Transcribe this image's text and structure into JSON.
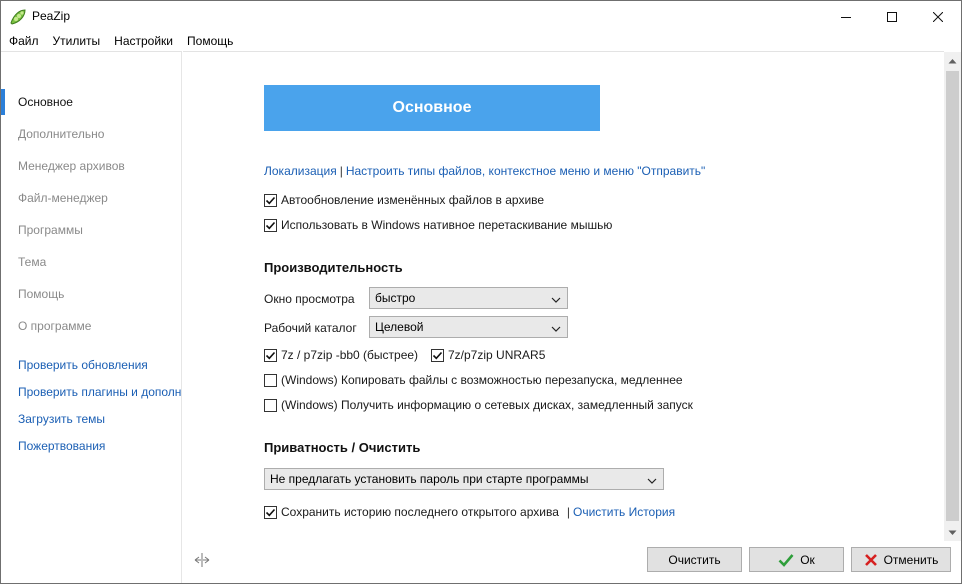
{
  "window": {
    "title": "PeaZip",
    "icon": "peazip-pea-icon"
  },
  "menu": [
    "Файл",
    "Утилиты",
    "Настройки",
    "Помощь"
  ],
  "sidebar": {
    "items": [
      {
        "label": "Основное",
        "active": true
      },
      {
        "label": "Дополнительно",
        "active": false
      },
      {
        "label": "Менеджер архивов",
        "active": false
      },
      {
        "label": "Файл-менеджер",
        "active": false
      },
      {
        "label": "Программы",
        "active": false
      },
      {
        "label": "Тема",
        "active": false
      },
      {
        "label": "Помощь",
        "active": false
      },
      {
        "label": "О программе",
        "active": false
      }
    ],
    "links": [
      "Проверить обновления",
      "Проверить плагины и дополн",
      "Загрузить темы",
      "Пожертвования"
    ]
  },
  "main": {
    "header": "Основное",
    "link_localization": "Локализация",
    "link_separator": "|",
    "link_filetypes": "Настроить типы файлов, контекстное меню и меню \"Отправить\"",
    "options": [
      {
        "label": "Автообновление изменённых файлов в архиве",
        "checked": true
      },
      {
        "label": "Использовать в Windows нативное перетаскивание мышью",
        "checked": true
      }
    ],
    "performance": {
      "title": "Производительность",
      "preview_label": "Окно просмотра",
      "preview_value": "быстро",
      "workdir_label": "Рабочий каталог",
      "workdir_value": "Целевой",
      "opt_7z_bb0": {
        "label": "7z / p7zip -bb0 (быстрее)",
        "checked": true
      },
      "opt_unrar": {
        "label": "7z/p7zip UNRAR5",
        "checked": true
      },
      "opt_copy_restart": {
        "label": "(Windows) Копировать файлы с возможностью перезапуска, медленнее",
        "checked": false
      },
      "opt_network_info": {
        "label": "(Windows) Получить информацию о сетевых дисках, замедленный запуск",
        "checked": false
      }
    },
    "privacy": {
      "title": "Приватность / Очистить",
      "password_select_value": "Не предлагать установить пароль при старте программы",
      "save_history": {
        "label": "Сохранить историю последнего открытого архива",
        "checked": true
      },
      "history_separator": "|",
      "clear_history_link": "Очистить История"
    }
  },
  "buttons": {
    "clear": "Очистить",
    "ok": "Ок",
    "cancel": "Отменить"
  },
  "colors": {
    "accent": "#4aa3ec",
    "link": "#1b5fb4",
    "active_marker": "#2b7fd8",
    "ok_check": "#2e9e3a",
    "cancel_x": "#d62020"
  }
}
